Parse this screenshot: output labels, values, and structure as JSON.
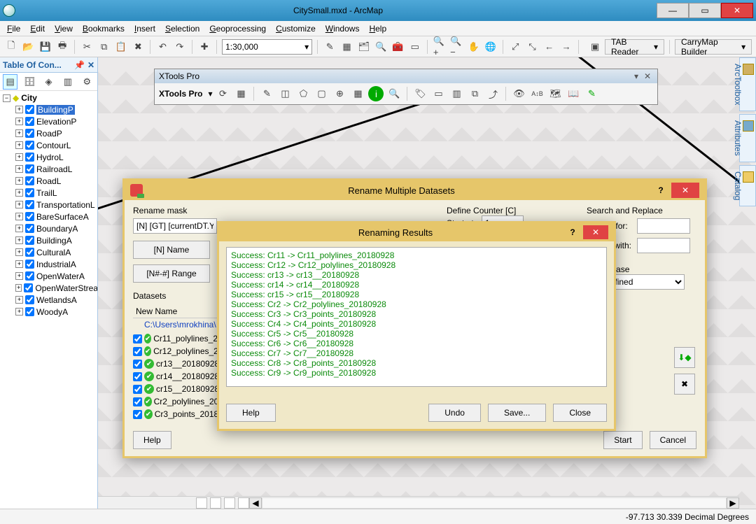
{
  "window": {
    "title": "CitySmall.mxd - ArcMap"
  },
  "menu": [
    "File",
    "Edit",
    "View",
    "Bookmarks",
    "Insert",
    "Selection",
    "Geoprocessing",
    "Customize",
    "Windows",
    "Help"
  ],
  "scale": "1:30,000",
  "toolbar_right": {
    "tab_reader": "TAB Reader",
    "carrymap": "CarryMap Builder"
  },
  "toc": {
    "title": "Table Of Con...",
    "root": "City",
    "layers": [
      "BuildingP",
      "ElevationP",
      "RoadP",
      "ContourL",
      "HydroL",
      "RailroadL",
      "RoadL",
      "TrailL",
      "TransportationL",
      "BareSurfaceA",
      "BoundaryA",
      "BuildingA",
      "CulturalA",
      "IndustrialA",
      "OpenWaterA",
      "OpenWaterStreamA",
      "WetlandsA",
      "WoodyA"
    ],
    "selected": 0
  },
  "side_tabs": [
    "ArcToolbox",
    "Attributes",
    "Catalog"
  ],
  "xtools": {
    "title": "XTools Pro",
    "label": "XTools Pro"
  },
  "rename_dialog": {
    "title": "Rename Multiple Datasets",
    "mask_label": "Rename mask",
    "mask_value": "[N] [GT] [currentDT.YMD]",
    "btn_name": "[N] Name",
    "btn_range": "[N#-#] Range",
    "datasets_label": "Datasets",
    "newname_label": "New Name",
    "path": "C:\\Users\\mrokhina\\",
    "counter_label": "Define Counter [C]",
    "counter_start": "Start at:",
    "counter_value": "1",
    "sr_label": "Search and Replace",
    "search_for": "Search for:",
    "replace_with": "Replace with:",
    "case_label": "Lower case",
    "case_value": "Not defined",
    "help": "Help",
    "start": "Start",
    "cancel": "Cancel",
    "items": [
      "Cr11_polylines_20180928",
      "Cr12_polylines_20180928",
      "cr13__20180928",
      "cr14__20180928",
      "cr15__20180928",
      "Cr2_polylines_20180928",
      "Cr3_points_20180928"
    ]
  },
  "results_dialog": {
    "title": "Renaming Results",
    "lines": [
      "Success: Cr11 -> Cr11_polylines_20180928",
      "Success: Cr12 -> Cr12_polylines_20180928",
      "Success: cr13 -> cr13__20180928",
      "Success: cr14 -> cr14__20180928",
      "Success: cr15 -> cr15__20180928",
      "Success: Cr2 -> Cr2_polylines_20180928",
      "Success: Cr3 -> Cr3_points_20180928",
      "Success: Cr4 -> Cr4_points_20180928",
      "Success: Cr5 -> Cr5__20180928",
      "Success: Cr6 -> Cr6__20180928",
      "Success: Cr7 -> Cr7__20180928",
      "Success: Cr8 -> Cr8_points_20180928",
      "Success: Cr9 -> Cr9_points_20180928"
    ],
    "help": "Help",
    "undo": "Undo",
    "save": "Save...",
    "close": "Close"
  },
  "status": {
    "coords": "-97.713  30.339 Decimal Degrees"
  }
}
